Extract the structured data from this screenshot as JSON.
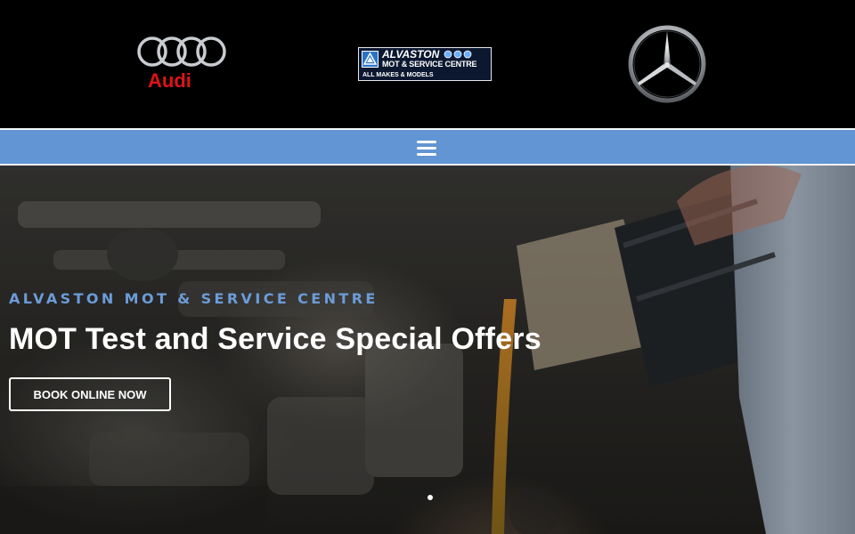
{
  "header": {
    "left_logo": {
      "brand": "Audi",
      "word": "Audi",
      "color": "#e0121b"
    },
    "center_logo": {
      "title": "ALVASTON",
      "subtitle": "MOT & SERVICE CENTRE",
      "footer": "ALL MAKES & MODELS"
    },
    "right_logo": {
      "brand": "Mercedes-Benz"
    }
  },
  "nav": {
    "menu_icon": "hamburger-menu-icon",
    "bar_color": "#6295d3"
  },
  "hero": {
    "kicker": "ALVASTON MOT & SERVICE CENTRE",
    "title": "MOT Test and Service Special Offers",
    "cta_label": "BOOK ONLINE NOW",
    "kicker_color": "#6b9cd9",
    "slides_count": 2,
    "active_slide": 1
  }
}
